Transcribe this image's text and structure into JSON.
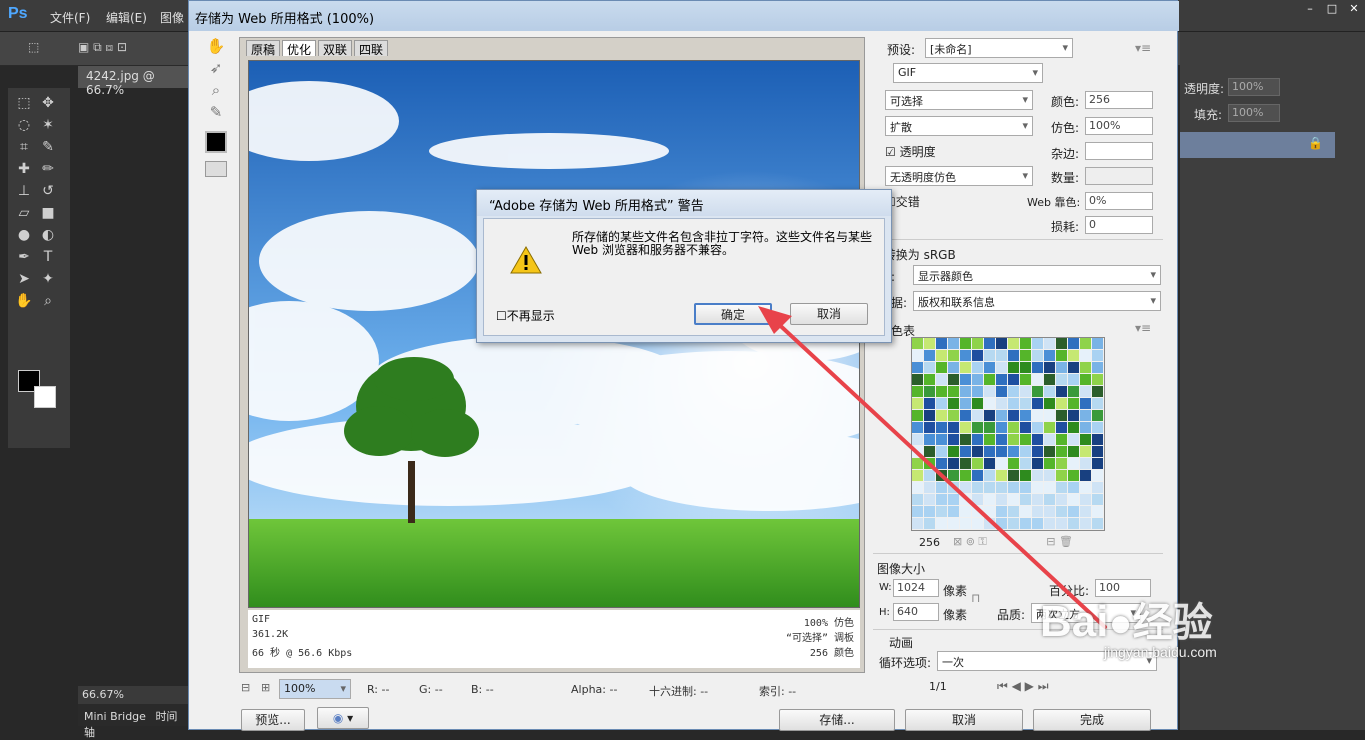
{
  "ps": {
    "logo": "Ps",
    "menus": [
      "文件(F)",
      "编辑(E)",
      "图像"
    ],
    "doc_tab": "4242.jpg @ 66.7%",
    "zoom_status": "66.67%",
    "bottom_tabs": [
      "Mini Bridge",
      "时间轴"
    ],
    "right_panel": {
      "opacity_label": "透明度:",
      "opacity_value": "100%",
      "fill_label": "填充:",
      "fill_value": "100%"
    }
  },
  "dialog": {
    "title": "存储为 Web 所用格式 (100%)",
    "tabs": [
      "原稿",
      "优化",
      "双联",
      "四联"
    ],
    "image_info": {
      "format": "GIF",
      "size": "361.2K",
      "time": "66 秒 @ 56.6 Kbps",
      "dither": "100% 仿色",
      "palette": "“可选择” 调板",
      "colors": "256 颜色"
    },
    "settings": {
      "preset_label": "预设:",
      "preset_value": "[未命名]",
      "format": "GIF",
      "reduction": "可选择",
      "dither_algo": "扩散",
      "transparency": "透明度",
      "trans_dither": "无透明度仿色",
      "interlaced": "交错",
      "colors_label": "颜色:",
      "colors_value": "256",
      "dither_label": "仿色:",
      "dither_value": "100%",
      "matte_label": "杂边:",
      "amount_label": "数量:",
      "websnap_label": "Web 靠色:",
      "websnap_value": "0%",
      "lossy_label": "损耗:",
      "lossy_value": "0",
      "convert_srgb": "转换为 sRGB",
      "preview_label": "览:",
      "preview_value": "显示器颜色",
      "metadata_label": "数据:",
      "metadata_value": "版权和联系信息",
      "color_table_label": "颜色表",
      "color_count": "256",
      "image_size_label": "图像大小",
      "w_label": "W:",
      "w_value": "1024",
      "h_label": "H:",
      "h_value": "640",
      "unit": "像素",
      "percent_label": "百分比:",
      "percent_value": "100",
      "quality_label": "品质:",
      "quality_value": "两次立方",
      "animation_label": "动画",
      "loop_label": "循环选项:",
      "loop_value": "一次",
      "frame_counter": "1/1"
    },
    "bottom": {
      "zoom": "100%",
      "r": "R: --",
      "g": "G: --",
      "b": "B: --",
      "alpha": "Alpha: --",
      "hex": "十六进制: --",
      "index": "索引: --"
    },
    "buttons": {
      "preview": "预览...",
      "save": "存储...",
      "cancel": "取消",
      "done": "完成"
    }
  },
  "alert": {
    "title": "“Adobe 存储为 Web 所用格式” 警告",
    "message": "所存储的某些文件名包含非拉丁字符。这些文件名与某些 Web 浏览器和服务器不兼容。",
    "dont_show": "不再显示",
    "ok": "确定",
    "cancel": "取消"
  },
  "watermark": {
    "brand": "Bai",
    "brand2": "经验",
    "url": "jingyan.baidu.com"
  }
}
